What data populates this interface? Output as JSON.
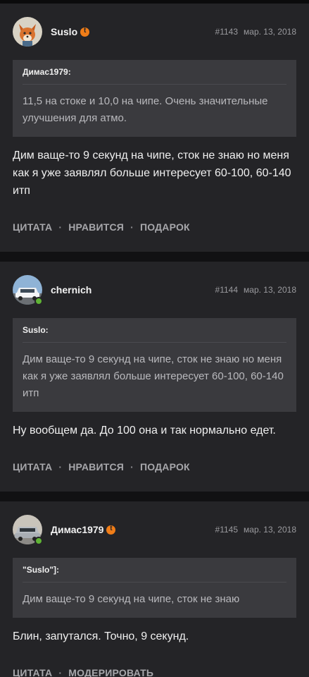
{
  "posts": [
    {
      "author": "Suslo",
      "has_badge": true,
      "online": false,
      "number": "#1143",
      "date": "мар. 13, 2018",
      "quote_author": "Димас1979:",
      "quote_text": "11,5 на стоке и 10,0 на чипе. Очень значительные улучшения для атмо.",
      "text": "Дим ваще-то 9 секунд на чипе, сток не знаю но меня как я уже заявлял больше интересует 60-100, 60-140 итп",
      "actions": [
        "ЦИТАТА",
        "НРАВИТСЯ",
        "ПОДАРОК"
      ]
    },
    {
      "author": "chernich",
      "has_badge": false,
      "online": true,
      "number": "#1144",
      "date": "мар. 13, 2018",
      "quote_author": "Suslo:",
      "quote_text": "Дим ваще-то 9 секунд на чипе, сток не знаю но меня как я уже заявлял больше интересует 60-100, 60-140 итп",
      "text": "Ну вообщем да. До 100 она и так нормально едет.",
      "actions": [
        "ЦИТАТА",
        "НРАВИТСЯ",
        "ПОДАРОК"
      ]
    },
    {
      "author": "Димас1979",
      "has_badge": true,
      "online": true,
      "number": "#1145",
      "date": "мар. 13, 2018",
      "quote_author": "\"Suslo\"]:",
      "quote_text": "Дим ваще-то 9 секунд на чипе, сток не знаю",
      "text": "Блин, запутался. Точно, 9 секунд.",
      "actions": [
        "ЦИТАТА",
        "МОДЕРИРОВАТЬ"
      ]
    }
  ],
  "colors": {
    "background": "#111113",
    "post_bg": "#242427",
    "quote_bg": "#3a3a3e",
    "badge": "#f07d18",
    "online": "#5fb435"
  },
  "icons": {
    "badge": "drive-badge-icon",
    "online": "online-indicator-icon"
  }
}
